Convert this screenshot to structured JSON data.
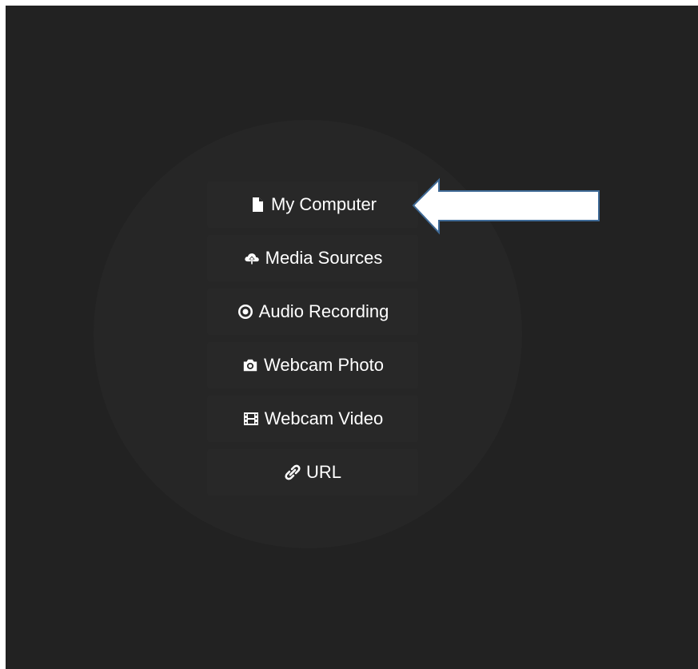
{
  "menu": {
    "items": [
      {
        "label": "My Computer",
        "icon": "file-icon"
      },
      {
        "label": "Media Sources",
        "icon": "cloud-upload-icon"
      },
      {
        "label": "Audio Recording",
        "icon": "record-icon"
      },
      {
        "label": "Webcam Photo",
        "icon": "camera-icon"
      },
      {
        "label": "Webcam Video",
        "icon": "film-icon"
      },
      {
        "label": "URL",
        "icon": "link-icon"
      }
    ]
  },
  "colors": {
    "background": "#222222",
    "circle": "#262626",
    "button": "#282828",
    "text": "#ffffff",
    "arrow_fill": "#ffffff",
    "arrow_stroke": "#3f6a96"
  }
}
